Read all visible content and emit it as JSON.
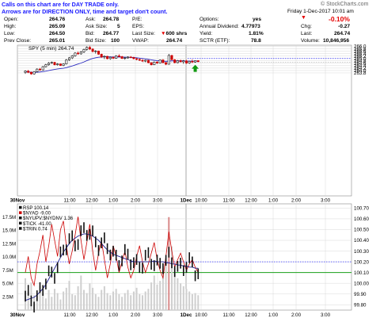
{
  "note_line1": "Calls on this chart are for DAY TRADE only.",
  "note_line2": "Arrows are for DIRECTION ONLY, time and target don't count.",
  "watermark": "© StockCharts.com",
  "date_line": "Friday  1-Dec-2017  10:01 am",
  "quote": {
    "open_label": "Open:",
    "open": "264.76",
    "high_label": "High:",
    "high": "265.09",
    "low_label": "Low:",
    "low": "264.50",
    "prev_label": "Prev Close:",
    "prev": "265.01",
    "ask_label": "Ask:",
    "ask": "264.78",
    "asksize_label": "Ask Size:",
    "asksize": "5",
    "bid_label": "Bid:",
    "bid": "264.77",
    "bidsize_label": "Bid Size:",
    "bidsize": "100",
    "pe_label": "P/E:",
    "pe": "",
    "eps_label": "EPS:",
    "eps": "",
    "lastsize_label": "Last Size:",
    "lastsize": "600 shrs",
    "vwap_label": "VWAP:",
    "vwap": "264.74",
    "options_label": "Options:",
    "options": "yes",
    "div_label": "Annual Dividend:",
    "div": "4.77973",
    "yield_label": "Yield:",
    "yield": "1.81%",
    "sctr_label": "SCTR (ETF):",
    "sctr": "78.8",
    "pct_change": "-0.10%",
    "chg_label": "Chg:",
    "chg": "-0.27",
    "last_label": "Last:",
    "last": "264.74",
    "volume_label": "Volume:",
    "volume": "10,846,956"
  },
  "colors": {
    "up": "#111111",
    "down": "#cc0000",
    "ma": "#2b2bbf",
    "rsp": "#1a1a8c",
    "nyad": "#cc0000",
    "grid": "#d8d8d8",
    "level": "#3333ff",
    "arrow": "#119911",
    "green_line": "#19a019"
  },
  "icons": {
    "arrow": "up-arrow-icon"
  },
  "chart_data": [
    {
      "type": "candlestick",
      "title": "SPY (5 min) 264.74",
      "ylim": [
        253.6,
        266.1
      ],
      "y_ticks": [
        "266.0",
        "265.8",
        "265.6",
        "265.4",
        "265.2",
        "265.0",
        "264.8",
        "264.6",
        "264.4",
        "264.2",
        "264.0",
        "263.8"
      ],
      "x_ticks": [
        "30Nov",
        "11:00",
        "12:00",
        "1:00",
        "2:00",
        "3:00",
        "1Dec",
        "10:00",
        "11:00",
        "12:00",
        "1:00",
        "2:00",
        "3:00"
      ],
      "candles": [
        [
          263.85,
          264.02,
          263.72,
          263.95
        ],
        [
          263.95,
          264.05,
          263.78,
          263.85
        ],
        [
          263.85,
          263.92,
          263.65,
          263.72
        ],
        [
          263.72,
          263.95,
          263.66,
          263.9
        ],
        [
          263.9,
          264.18,
          263.85,
          264.12
        ],
        [
          264.12,
          264.22,
          263.98,
          264.05
        ],
        [
          264.05,
          264.38,
          264.0,
          264.32
        ],
        [
          264.32,
          264.55,
          264.25,
          264.48
        ],
        [
          264.48,
          264.7,
          264.4,
          264.62
        ],
        [
          264.62,
          264.75,
          264.55,
          264.68
        ],
        [
          264.68,
          264.72,
          264.42,
          264.48
        ],
        [
          264.48,
          264.62,
          264.4,
          264.55
        ],
        [
          264.55,
          264.58,
          264.38,
          264.42
        ],
        [
          264.42,
          264.6,
          264.36,
          264.55
        ],
        [
          264.55,
          264.95,
          264.5,
          264.88
        ],
        [
          264.88,
          265.12,
          264.8,
          265.05
        ],
        [
          265.05,
          265.3,
          264.95,
          265.22
        ],
        [
          265.22,
          265.52,
          265.15,
          265.45
        ],
        [
          265.45,
          265.58,
          265.3,
          265.38
        ],
        [
          265.38,
          265.62,
          265.32,
          265.55
        ],
        [
          265.55,
          265.82,
          265.45,
          265.75
        ],
        [
          265.75,
          266.0,
          265.65,
          265.92
        ],
        [
          265.92,
          266.05,
          265.7,
          265.78
        ],
        [
          265.78,
          265.85,
          265.5,
          265.58
        ],
        [
          265.58,
          265.7,
          265.4,
          265.62
        ],
        [
          265.62,
          265.65,
          265.3,
          265.35
        ],
        [
          265.35,
          265.4,
          265.05,
          265.12
        ],
        [
          265.12,
          265.25,
          264.95,
          265.18
        ],
        [
          265.18,
          265.22,
          264.92,
          264.98
        ],
        [
          264.98,
          265.15,
          264.9,
          265.1
        ],
        [
          265.1,
          265.18,
          264.95,
          265.02
        ],
        [
          265.02,
          265.28,
          264.98,
          265.22
        ],
        [
          265.22,
          265.35,
          265.1,
          265.15
        ],
        [
          265.15,
          265.22,
          264.95,
          265.0
        ],
        [
          265.0,
          265.12,
          264.9,
          265.05
        ],
        [
          265.05,
          265.18,
          264.98,
          265.12
        ],
        [
          265.12,
          265.2,
          265.02,
          265.08
        ],
        [
          265.08,
          265.15,
          264.92,
          264.98
        ],
        [
          264.98,
          265.05,
          264.85,
          264.92
        ],
        [
          264.92,
          265.0,
          264.8,
          264.85
        ],
        [
          264.85,
          264.95,
          264.72,
          264.78
        ],
        [
          264.78,
          264.9,
          264.7,
          264.85
        ],
        [
          264.85,
          264.88,
          264.6,
          264.65
        ],
        [
          264.65,
          264.7,
          264.42,
          264.48
        ],
        [
          264.48,
          264.75,
          264.45,
          264.7
        ],
        [
          264.7,
          264.78,
          264.55,
          264.62
        ],
        [
          264.62,
          264.92,
          264.58,
          264.88
        ],
        [
          264.88,
          264.95,
          264.6,
          264.65
        ],
        [
          264.65,
          264.72,
          264.45,
          264.52
        ],
        [
          264.52,
          265.38,
          264.5,
          265.25
        ],
        [
          265.25,
          265.3,
          264.85,
          264.9
        ],
        [
          264.9,
          264.95,
          264.6,
          264.65
        ],
        [
          264.65,
          264.88,
          264.6,
          264.82
        ],
        [
          264.82,
          264.92,
          264.68,
          264.72
        ],
        [
          264.72,
          264.88,
          264.55,
          264.8
        ],
        [
          264.8,
          264.88,
          264.55,
          264.62
        ],
        [
          264.62,
          264.8,
          264.55,
          264.76
        ],
        [
          264.76,
          264.92,
          264.62,
          264.7
        ],
        [
          264.7,
          264.85,
          264.65,
          264.82
        ],
        [
          264.82,
          264.85,
          264.68,
          264.74
        ]
      ],
      "ma": [
        263.9,
        263.88,
        263.86,
        263.85,
        263.86,
        263.88,
        263.91,
        263.95,
        264.0,
        264.05,
        264.09,
        264.13,
        264.16,
        264.19,
        264.24,
        264.31,
        264.38,
        264.46,
        264.54,
        264.62,
        264.71,
        264.82,
        264.92,
        265.0,
        265.06,
        265.1,
        265.12,
        265.14,
        265.14,
        265.13,
        265.12,
        265.12,
        265.13,
        265.12,
        265.11,
        265.1,
        265.09,
        265.08,
        265.06,
        265.03,
        265.0,
        264.97,
        264.93,
        264.89,
        264.85,
        264.82,
        264.8,
        264.78,
        264.76,
        264.78,
        264.8,
        264.8,
        264.8,
        264.8,
        264.8,
        264.79,
        264.79,
        264.78,
        264.78,
        264.78
      ],
      "level_lines": [
        265.0,
        264.7
      ]
    },
    {
      "type": "line",
      "legend": [
        "RSP 100.14",
        "$NYAD -9.00",
        "$NYUPV:$NYDNV 1.36",
        "$TICK -41.00",
        "$TRIN 0.74"
      ],
      "left_ticks": [
        "17.5M",
        "15.0M",
        "12.5M",
        "10.0M",
        "7.5M",
        "5.0M",
        "2.5M"
      ],
      "right_ticks": [
        "100.70",
        "100.60",
        "100.50",
        "100.40",
        "100.30",
        "100.20",
        "100.10",
        "100.00",
        "99.90",
        "99.80"
      ],
      "rsp_ylim": [
        99.75,
        100.74
      ],
      "rsp_ma": [
        99.84,
        99.85,
        99.86,
        99.87,
        99.89,
        99.92,
        99.95,
        99.99,
        100.04,
        100.09,
        100.14,
        100.19,
        100.24,
        100.29,
        100.33,
        100.37,
        100.4,
        100.42,
        100.44,
        100.45,
        100.46,
        100.46,
        100.45,
        100.44,
        100.42,
        100.4,
        100.37,
        100.34,
        100.31,
        100.29,
        100.27,
        100.26,
        100.25,
        100.24,
        100.23,
        100.22,
        100.21,
        100.2,
        100.2,
        100.2,
        100.2,
        100.2,
        100.2,
        100.2,
        100.21,
        100.2,
        100.2,
        100.2,
        100.19,
        100.19,
        100.18,
        100.18,
        100.17,
        100.17,
        100.16,
        100.16,
        100.15,
        100.15,
        100.14,
        100.14
      ],
      "nyad": [
        100.1,
        100.25,
        100.05,
        99.98,
        100.18,
        100.3,
        100.45,
        100.2,
        100.35,
        100.55,
        100.4,
        100.25,
        100.5,
        100.58,
        100.35,
        100.18,
        100.3,
        100.45,
        100.62,
        100.4,
        100.22,
        100.38,
        100.55,
        100.3,
        100.12,
        100.28,
        100.4,
        100.22,
        100.05,
        100.18,
        100.35,
        100.25,
        100.1,
        100.2,
        100.3,
        100.15,
        100.05,
        100.12,
        100.25,
        100.35,
        100.2,
        100.1,
        100.18,
        100.28,
        100.38,
        100.22,
        100.12,
        100.05,
        100.25,
        100.48,
        100.3,
        100.15,
        100.22,
        100.28,
        100.2,
        100.12,
        100.18,
        100.22,
        100.15,
        100.1
      ],
      "volume_m": [
        6.0,
        3.5,
        5.2,
        2.8,
        3.0,
        4.5,
        3.0,
        2.2,
        3.8,
        2.5,
        4.0,
        3.2,
        2.0,
        3.5,
        4.2,
        5.5,
        3.0,
        2.8,
        4.5,
        6.5,
        3.8,
        3.2,
        5.0,
        4.2,
        3.0,
        2.5,
        3.8,
        4.5,
        3.2,
        2.8,
        3.5,
        4.0,
        3.0,
        2.5,
        3.2,
        3.8,
        2.8,
        3.5,
        4.2,
        3.0,
        2.8,
        3.5,
        4.0,
        5.2,
        6.5,
        4.8,
        5.5,
        7.0,
        9.0,
        17.5,
        12.0,
        8.0,
        6.0,
        5.0,
        4.5,
        4.0,
        3.5,
        3.0,
        3.2,
        2.8
      ],
      "hlines": [
        100.2,
        100.1
      ]
    }
  ]
}
